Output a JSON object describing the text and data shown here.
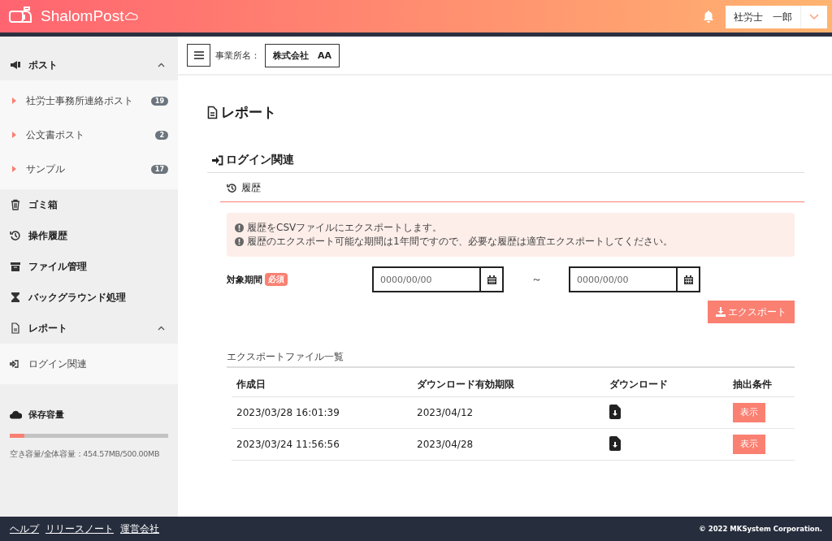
{
  "header": {
    "logo": "ShalomPost",
    "user": "社労士　一郎"
  },
  "sidebar": {
    "menu": [
      {
        "kind": "group",
        "label": "ポスト",
        "expanded": true,
        "children": [
          {
            "label": "社労士事務所連絡ポスト",
            "count": "19"
          },
          {
            "label": "公文書ポスト",
            "count": "2"
          },
          {
            "label": "サンプル",
            "count": "17"
          }
        ]
      },
      {
        "kind": "link",
        "label": "ゴミ箱"
      },
      {
        "kind": "link",
        "label": "操作履歴"
      },
      {
        "kind": "link",
        "label": "ファイル管理"
      },
      {
        "kind": "link",
        "label": "バックグラウンド処理"
      },
      {
        "kind": "group",
        "label": "レポート",
        "expanded": true,
        "children": [
          {
            "label": "ログイン関連"
          }
        ]
      }
    ],
    "storage": {
      "title": "保存容量",
      "level": 0.09,
      "text": "空き容量/全体容量：454.57MB/500.00MB"
    }
  },
  "topbar": {
    "office_label": "事業所名：",
    "office": "株式会社　AA"
  },
  "page": {
    "title": "レポート",
    "section": "ログイン関連",
    "tab": "履歴",
    "notices": [
      "履歴をCSVファイルにエクスポートします。",
      "履歴のエクスポート可能な期間は1年間ですので、必要な履歴は適宜エクスポートしてください。"
    ],
    "period_label": "対象期間",
    "required": "必須",
    "from": {
      "placeholder": "0000/00/00"
    },
    "separator": "～",
    "to": {
      "placeholder": "0000/00/00"
    },
    "export_button": "エクスポート",
    "list_title": "エクスポートファイル一覧",
    "table": {
      "columns": [
        "作成日",
        "ダウンロード有効期限",
        "ダウンロード",
        "抽出条件"
      ],
      "rows": [
        {
          "created": "2023/03/28 16:01:39",
          "expires": "2023/04/12",
          "action": "表示"
        },
        {
          "created": "2023/03/24 11:56:56",
          "expires": "2023/04/28",
          "action": "表示"
        }
      ]
    }
  },
  "footer": {
    "links": [
      "ヘルプ",
      "リリースノート",
      "運営会社"
    ],
    "copyright": "© 2022 MKSystem Corporation."
  }
}
